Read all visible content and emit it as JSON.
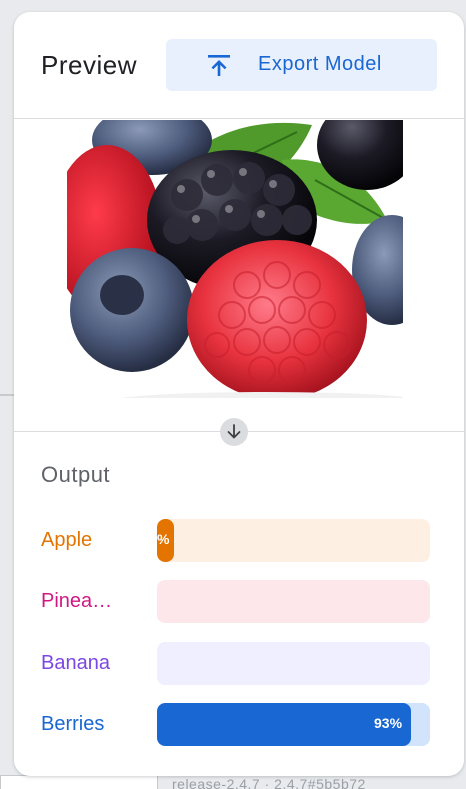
{
  "header": {
    "title": "Preview",
    "export_label": "Export Model",
    "export_icon": "upload-icon"
  },
  "preview": {
    "image_subject": "berries-photo"
  },
  "output": {
    "title": "Output",
    "classes": [
      {
        "label": "Apple",
        "confidence": 0.06,
        "pct_label": "%",
        "color": "#e37400",
        "track": "#feefe3"
      },
      {
        "label": "Pinea…",
        "confidence": 0.0,
        "pct_label": "",
        "color": "#d01884",
        "track": "#fde7ea"
      },
      {
        "label": "Banana",
        "confidence": 0.0,
        "pct_label": "",
        "color": "#7b47e3",
        "track": "#f0efff"
      },
      {
        "label": "Berries",
        "confidence": 0.93,
        "pct_label": "93%",
        "color": "#1967d2",
        "track": "#d2e3fc"
      }
    ]
  },
  "background": {
    "footer_text": "release-2.4.7 · 2.4.7#5b5b72"
  }
}
